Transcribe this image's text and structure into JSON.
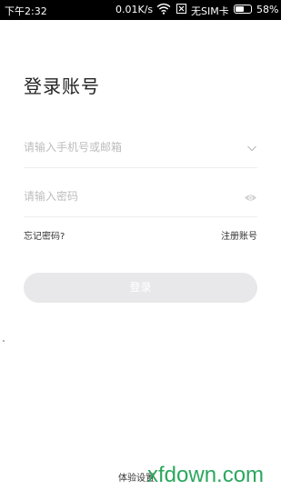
{
  "status_bar": {
    "time": "下午2:32",
    "network_speed": "0.01K/s",
    "sim_status": "无SIM卡",
    "battery_percent": "58%",
    "battery_level": 0.58,
    "icons": [
      "wifi-icon",
      "no-sim-icon",
      "battery-icon"
    ]
  },
  "page": {
    "title": "登录账号"
  },
  "form": {
    "account_placeholder": "请输入手机号或邮箱",
    "password_placeholder": "请输入密码",
    "account_icon": "chevron-down-icon",
    "password_icon": "eye-icon"
  },
  "links": {
    "forgot_password": "忘记密码?",
    "register": "注册账号"
  },
  "login_button": {
    "label": "登录",
    "color": "#e8e8ea"
  },
  "footer": {
    "experience_label": "体验设置"
  },
  "watermark": {
    "text": "xfdown.com",
    "color": "#20a356"
  }
}
